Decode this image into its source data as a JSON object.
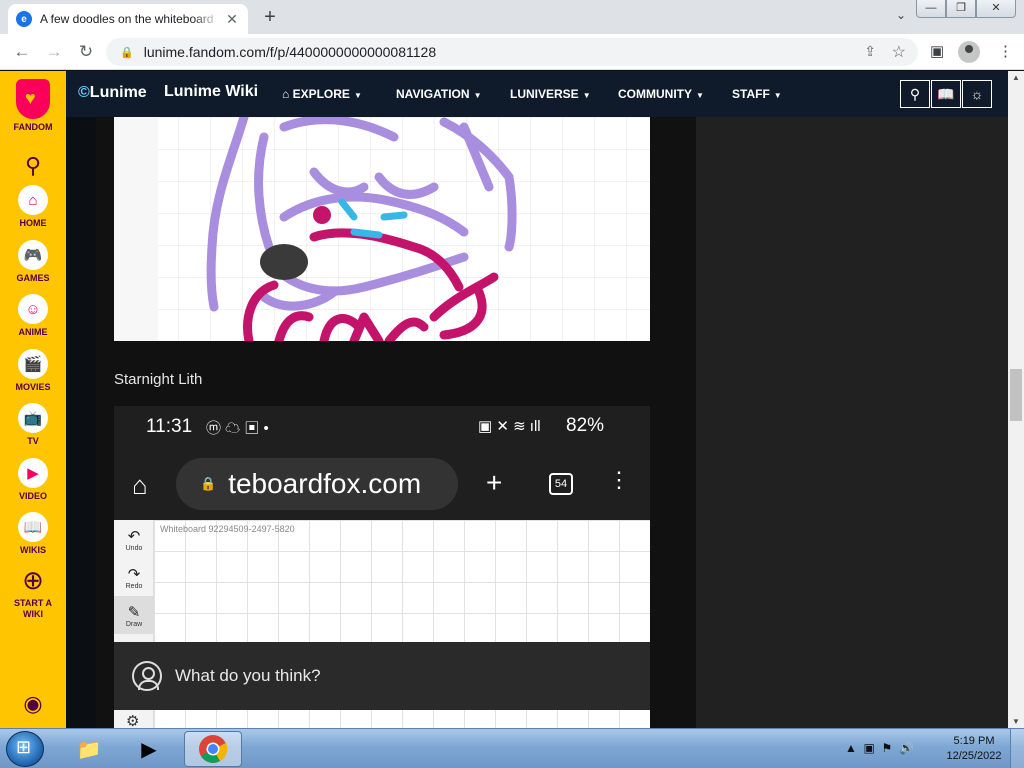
{
  "browser": {
    "tab_title": "A few doodles on the whiteboard",
    "tab_close": "✕",
    "new_tab": "+",
    "url": "lunime.fandom.com/f/p/4400000000000081128",
    "window_min": "—",
    "window_max": "❐",
    "window_close": "✕"
  },
  "rail": {
    "logo_label": "FANDOM",
    "items": [
      {
        "label": "HOME",
        "icon": "home-icon",
        "glyph": "⌂"
      },
      {
        "label": "GAMES",
        "icon": "gamepad-icon",
        "glyph": "🎮"
      },
      {
        "label": "ANIME",
        "icon": "anime-icon",
        "glyph": "☺"
      },
      {
        "label": "MOVIES",
        "icon": "clapper-icon",
        "glyph": "🎬"
      },
      {
        "label": "TV",
        "icon": "tv-icon",
        "glyph": "📺"
      },
      {
        "label": "VIDEO",
        "icon": "play-icon",
        "glyph": "▶"
      },
      {
        "label": "WIKIS",
        "icon": "book-icon",
        "glyph": "📖"
      }
    ],
    "start_a_wiki_1": "START A",
    "start_a_wiki_2": "WIKI"
  },
  "wiki_header": {
    "logo": "Lunime",
    "wiki_name": "Lunime Wiki",
    "nav": [
      "EXPLORE",
      "NAVIGATION",
      "LUNIVERSE",
      "COMMUNITY",
      "STAFF"
    ]
  },
  "post": {
    "caption": "Starnight Lith",
    "phone": {
      "time": "11:31",
      "battery": "82%",
      "url": "teboardfox.com",
      "tab_count": "54",
      "whiteboard_title": "Whiteboard 92294509-2497-5820",
      "tools": [
        "Undo",
        "Redo",
        "Draw"
      ]
    }
  },
  "comment": {
    "prompt": "What do you think?"
  },
  "taskbar": {
    "time": "5:19 PM",
    "date": "12/25/2022"
  },
  "colors": {
    "fandom_yellow": "#ffc500",
    "fandom_pink": "#fa005a",
    "wiki_header_bg": "#0f1a2b"
  }
}
